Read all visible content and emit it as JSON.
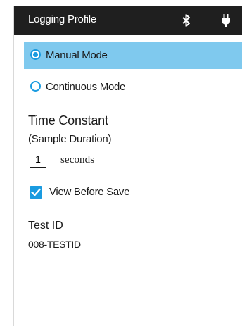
{
  "header": {
    "title": "Logging Profile",
    "icons": [
      "bluetooth-icon",
      "power-plug-icon"
    ]
  },
  "modes": {
    "manual_label": "Manual Mode",
    "continuous_label": "Continuous Mode",
    "selected": "Manual Mode"
  },
  "time_constant": {
    "heading": "Time Constant",
    "subheading": "(Sample Duration)",
    "value": "1",
    "unit": "seconds"
  },
  "view_before_save": {
    "label": "View Before Save",
    "checked": true
  },
  "test_id": {
    "heading": "Test ID",
    "value": "008-TESTID"
  },
  "colors": {
    "titlebar": "#1f1f1f",
    "selected_row": "#7fc9ee",
    "accent": "#1a9be0"
  }
}
